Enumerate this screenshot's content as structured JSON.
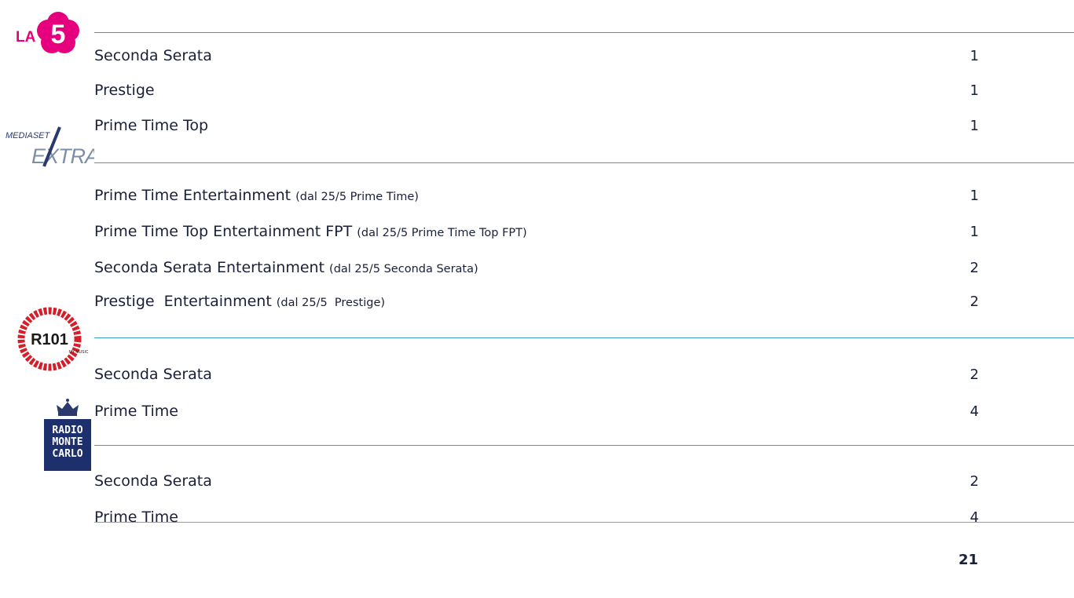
{
  "colors": {
    "divider": "#3aa0c0",
    "footer_divider": "#9a9a9a",
    "la5_pink": "#e6007e",
    "r101_red": "#d41f2a",
    "rmc_navy": "#1e2f6e"
  },
  "logos": {
    "la5": {
      "text_la": "LA",
      "text_5": "5"
    },
    "mediaset_extra": {
      "top": "MEDIASET",
      "main": "EXTRA"
    },
    "r101": {
      "text": "R101",
      "sub": "MY MUSIC"
    },
    "rmc": {
      "lines": [
        "RADIO",
        "MONTE",
        "CARLO"
      ]
    }
  },
  "sections": [
    {
      "name": "la5",
      "rows": [
        {
          "label": "Seconda Serata",
          "note": "",
          "value": "1"
        },
        {
          "label": "Prestige",
          "note": "",
          "value": "1"
        },
        {
          "label": "Prime Time Top",
          "note": "",
          "value": "1"
        }
      ]
    },
    {
      "name": "mediaset-extra",
      "rows": [
        {
          "label": "Prime Time Entertainment",
          "note": "(dal 25/5 Prime Time)",
          "value": "1"
        },
        {
          "label": "Prime Time Top Entertainment FPT",
          "note": "(dal 25/5 Prime Time Top FPT)",
          "value": "1"
        },
        {
          "label": "Seconda Serata Entertainment",
          "note": "(dal 25/5 Seconda Serata)",
          "value": "2"
        },
        {
          "label": "Prestige  Entertainment",
          "note": "(dal 25/5  Prestige)",
          "value": "2"
        }
      ]
    },
    {
      "name": "r101",
      "rows": [
        {
          "label": "Seconda Serata",
          "note": "",
          "value": "2"
        },
        {
          "label": "Prime Time",
          "note": "",
          "value": "4"
        }
      ]
    },
    {
      "name": "radio-monte-carlo",
      "rows": [
        {
          "label": "Seconda Serata",
          "note": "",
          "value": "2"
        },
        {
          "label": "Prime Time",
          "note": "",
          "value": "4"
        }
      ]
    }
  ],
  "page_number": "21"
}
